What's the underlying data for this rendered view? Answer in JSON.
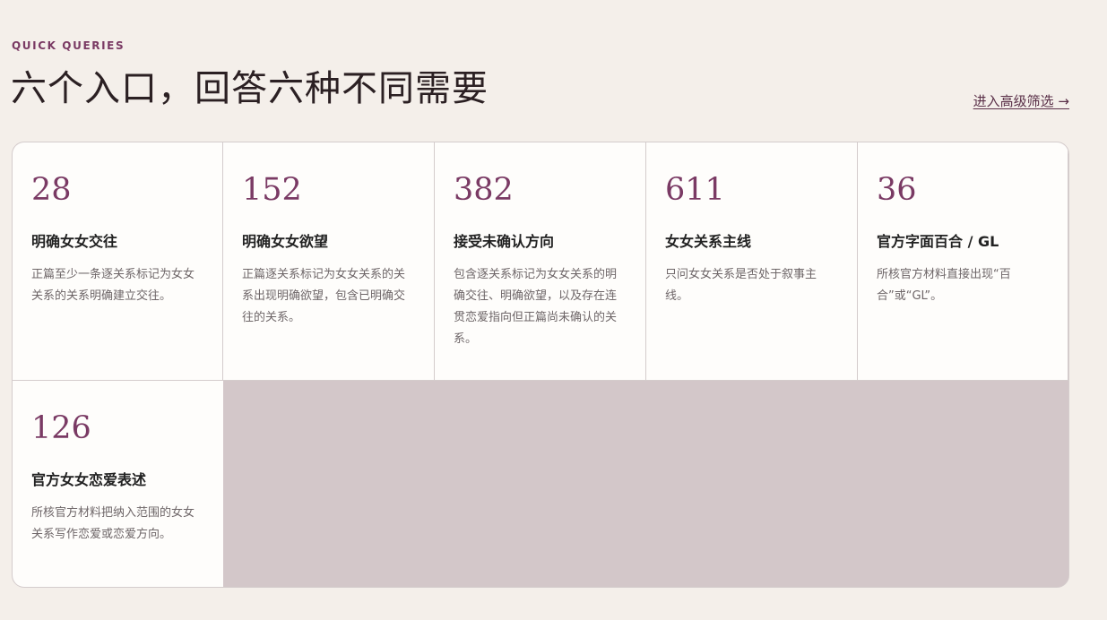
{
  "header": {
    "eyebrow": "QUICK QUERIES",
    "title": "六个入口，回答六种不同需要",
    "advanced_link": "进入高级筛选 →"
  },
  "cards": [
    {
      "count": "28",
      "title": "明确女女交往",
      "description": "正篇至少一条逐关系标记为女女关系的关系明确建立交往。"
    },
    {
      "count": "152",
      "title": "明确女女欲望",
      "description": "正篇逐关系标记为女女关系的关系出现明确欲望，包含已明确交往的关系。"
    },
    {
      "count": "382",
      "title": "接受未确认方向",
      "description": "包含逐关系标记为女女关系的明确交往、明确欲望，以及存在连贯恋爱指向但正篇尚未确认的关系。"
    },
    {
      "count": "611",
      "title": "女女关系主线",
      "description": "只问女女关系是否处于叙事主线。"
    },
    {
      "count": "36",
      "title": "官方字面百合 / GL",
      "description": "所核官方材料直接出现“百合”或“GL”。"
    },
    {
      "count": "126",
      "title": "官方女女恋爱表述",
      "description": "所核官方材料把纳入范围的女女关系写作恋爱或恋爱方向。"
    }
  ],
  "colors": {
    "accent": "#7a3a64",
    "background": "#f4efea",
    "card_background": "#fefdfb",
    "empty_area": "#d3c7c9"
  }
}
